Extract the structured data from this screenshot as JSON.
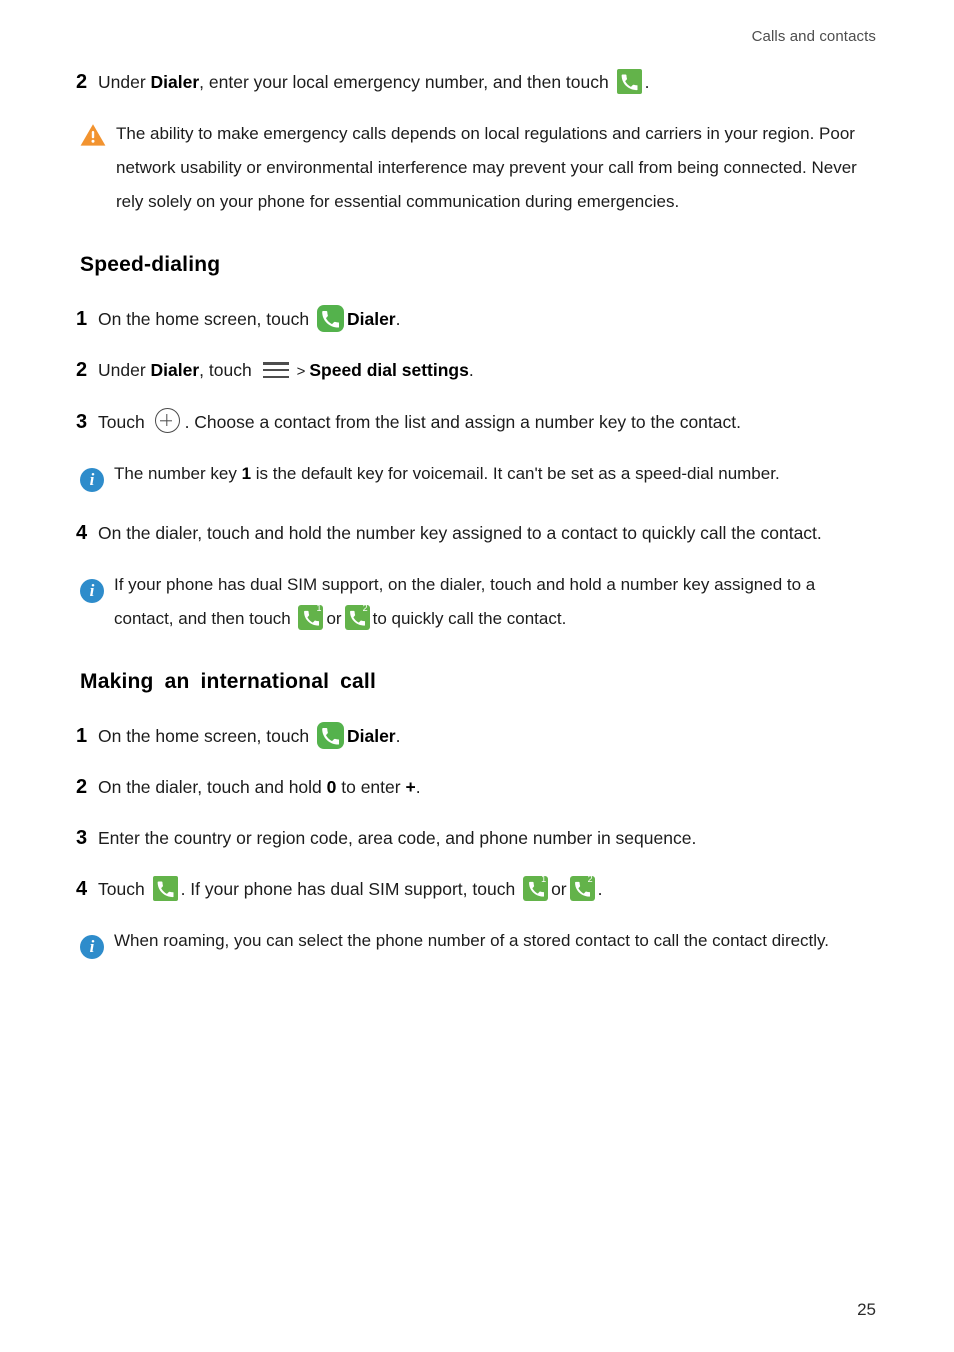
{
  "header": {
    "running_head": "Calls and contacts"
  },
  "footer": {
    "page_number": "25"
  },
  "colors": {
    "dialer_green": "#54b24c",
    "dialer_green_flat": "#63b34a",
    "warning_orange": "#f2932f",
    "info_blue": "#2e8ccb",
    "text": "#1c1c1c",
    "header_text": "#4d4d4d"
  },
  "icons": {
    "dialer": "dialer-icon",
    "dialer_sim1": "dialer-sim1-icon",
    "dialer_sim2": "dialer-sim2-icon",
    "menu": "hamburger-menu-icon",
    "add": "add-plus-circle-icon",
    "warning": "warning-triangle-icon",
    "info": "info-circle-icon"
  },
  "emergency_step": {
    "number": "2",
    "text_before": "Under ",
    "bold_1": "Dialer",
    "text_after": ", enter your local emergency number, and then touch ",
    "period": "."
  },
  "warning_note": {
    "text": "The ability to make emergency calls depends on local regulations and carriers in your region. Poor network usability or environmental interference may prevent your call from being connected. Never rely solely on your phone for essential communication during emergencies."
  },
  "speed_dialing": {
    "heading": "Speed-dialing",
    "step1": {
      "number": "1",
      "text_before": "On the home screen, touch ",
      "bold_1": "Dialer",
      "text_after": "."
    },
    "step2": {
      "number": "2",
      "text_before": "Under ",
      "bold_1": "Dialer",
      "text_mid": ", touch ",
      "separator": ">",
      "bold_2": "Speed dial settings",
      "text_after": "."
    },
    "step3": {
      "number": "3",
      "text_before": "Touch ",
      "text_after": ". Choose a contact from the list and assign a number key to the contact."
    },
    "note1": {
      "text_before": "The number key ",
      "bold_1": "1",
      "text_after": " is the default key for voicemail. It can't be set as a speed-dial number."
    },
    "step4": {
      "number": "4",
      "text": "On the dialer, touch and hold the number key assigned to a contact to quickly call the contact."
    },
    "note2": {
      "text_before": "If your phone has dual SIM support, on the dialer, touch and hold a number key assigned to a contact, and then touch ",
      "text_or": "or",
      "text_after": "to quickly call the contact."
    }
  },
  "international_call": {
    "heading": "Making an international call",
    "step1": {
      "number": "1",
      "text_before": "On the home screen, touch ",
      "bold_1": "Dialer",
      "text_after": "."
    },
    "step2": {
      "number": "2",
      "text_before": "On the dialer, touch and hold ",
      "bold_1": "0",
      "text_mid": " to enter ",
      "bold_2": "+",
      "text_after": "."
    },
    "step3": {
      "number": "3",
      "text": "Enter the country or region code, area code, and phone number in sequence."
    },
    "step4": {
      "number": "4",
      "text_before": "Touch ",
      "text_mid": ". If your phone has dual SIM support, touch ",
      "text_or": "or",
      "text_after": "."
    },
    "note1": {
      "text": "When roaming, you can select the phone number of a stored contact to call the contact directly."
    }
  },
  "sim_labels": {
    "sim1": "1",
    "sim2": "2"
  }
}
